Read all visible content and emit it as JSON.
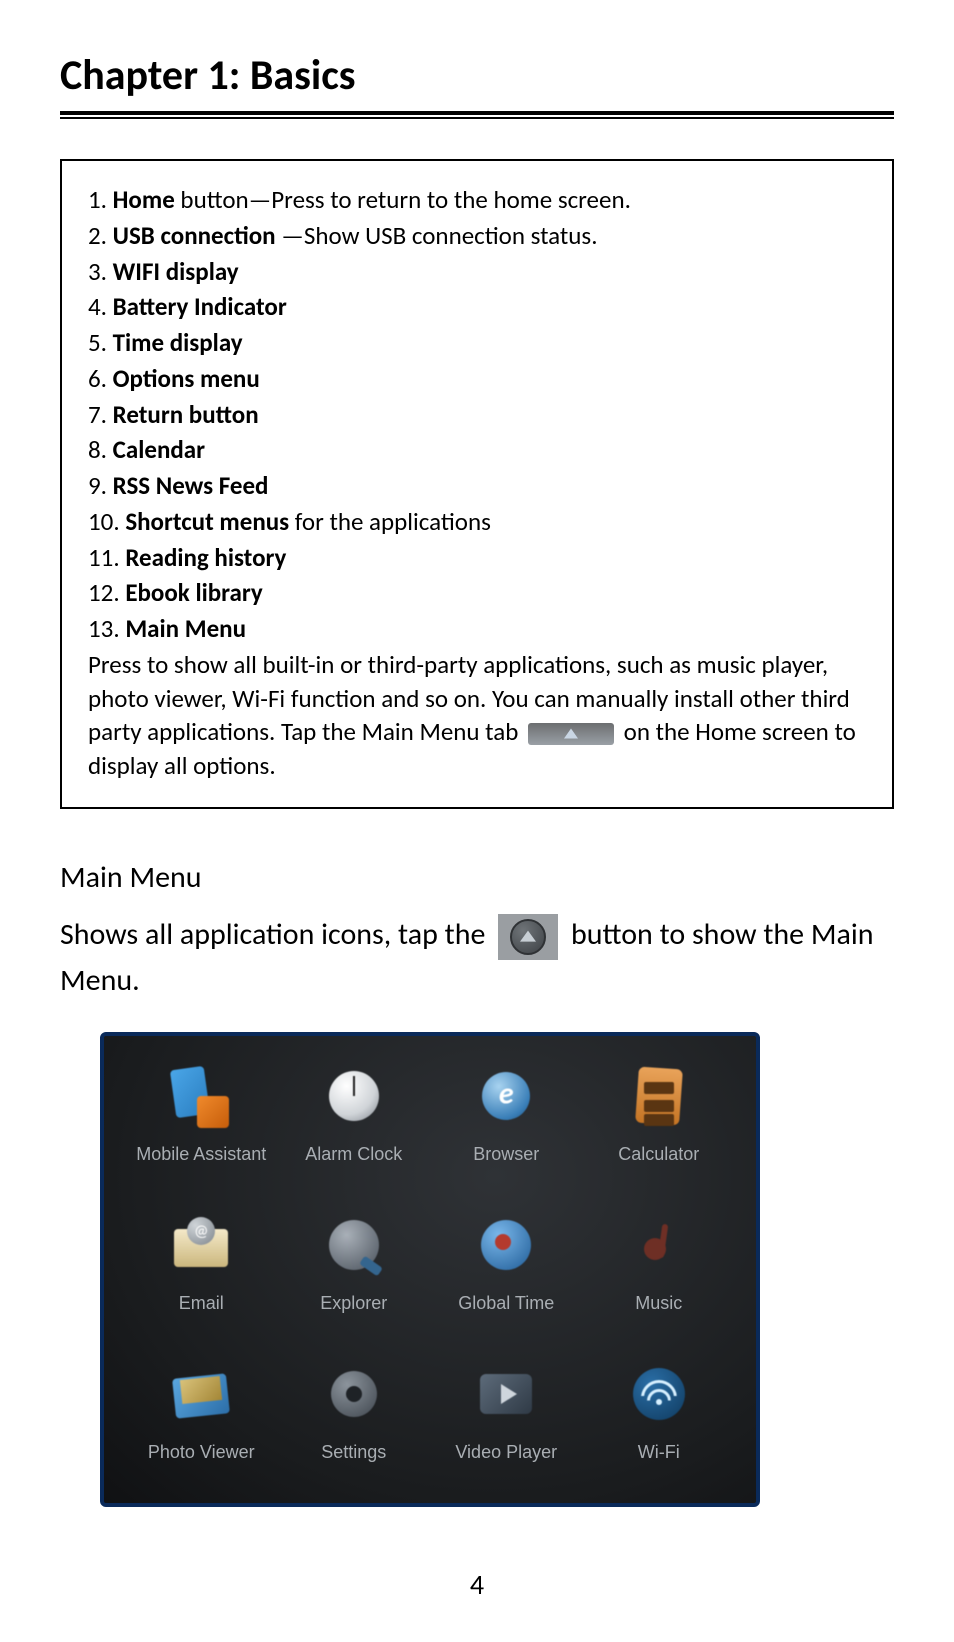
{
  "chapter_title": "Chapter 1: Basics",
  "box_items": [
    {
      "num": "1.",
      "bold": "Home",
      "rest": " button—Press to return to the home screen."
    },
    {
      "num": "2.",
      "bold": "USB connection",
      "rest": " —Show USB connection status."
    },
    {
      "num": "3.",
      "bold": "WIFI display",
      "rest": ""
    },
    {
      "num": "4.",
      "bold": "Battery Indicator",
      "rest": ""
    },
    {
      "num": "5.",
      "bold": "Time display",
      "rest": ""
    },
    {
      "num": "6.",
      "bold": "Options menu",
      "rest": ""
    },
    {
      "num": "7.",
      "bold": " Return button",
      "rest": ""
    },
    {
      "num": "8.",
      "bold": "Calendar",
      "rest": ""
    },
    {
      "num": "9.",
      "bold": "RSS News Feed",
      "rest": ""
    },
    {
      "num": "10.",
      "bold": " Shortcut menus",
      "rest": " for the applications"
    },
    {
      "num": "11.",
      "bold": " Reading history",
      "rest": ""
    },
    {
      "num": "12.",
      "bold": " Ebook library",
      "rest": ""
    },
    {
      "num": "13.",
      "bold": " Main Menu",
      "rest": ""
    }
  ],
  "box_tail_pre": "Press to show all built-in or third-party applications, such as music player, photo viewer, Wi-Fi function and so on. You can manually install other third party applications.  Tap the Main Menu tab ",
  "box_tail_post": " on the Home screen to display all options.",
  "section_heading": "Main Menu",
  "body_line_pre": "Shows all application icons, tap the ",
  "body_line_post": " button to show the Main Menu.",
  "apps": [
    {
      "label": "Mobile Assistant",
      "icon": "ico-mobile"
    },
    {
      "label": "Alarm Clock",
      "icon": "ico-clock"
    },
    {
      "label": "Browser",
      "icon": "ico-browser"
    },
    {
      "label": "Calculator",
      "icon": "ico-calc"
    },
    {
      "label": "Email",
      "icon": "ico-email"
    },
    {
      "label": "Explorer",
      "icon": "ico-explorer"
    },
    {
      "label": "Global Time",
      "icon": "ico-globaltime"
    },
    {
      "label": "Music",
      "icon": "ico-music"
    },
    {
      "label": "Photo Viewer",
      "icon": "ico-photo"
    },
    {
      "label": "Settings",
      "icon": "ico-settings"
    },
    {
      "label": "Video Player",
      "icon": "ico-video"
    },
    {
      "label": "Wi-Fi",
      "icon": "ico-wifi"
    }
  ],
  "page_number": "4"
}
